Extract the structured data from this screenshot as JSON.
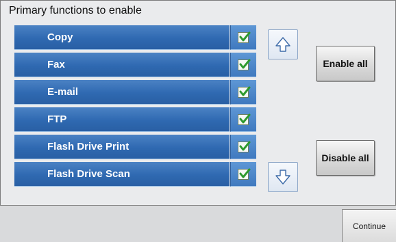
{
  "title": "Primary functions to enable",
  "functions": [
    {
      "label": "Copy",
      "checked": true
    },
    {
      "label": "Fax",
      "checked": true
    },
    {
      "label": "E-mail",
      "checked": true
    },
    {
      "label": "FTP",
      "checked": true
    },
    {
      "label": "Flash Drive Print",
      "checked": true
    },
    {
      "label": "Flash Drive Scan",
      "checked": true
    }
  ],
  "buttons": {
    "enable_all": "Enable all",
    "disable_all": "Disable all",
    "continue": "Continue"
  },
  "icons": {
    "scroll_up": "arrow-up-icon",
    "scroll_down": "arrow-down-icon",
    "check": "checkmark-icon"
  },
  "colors": {
    "row_blue": "#2f69b1",
    "check_green": "#2e9a2e"
  }
}
